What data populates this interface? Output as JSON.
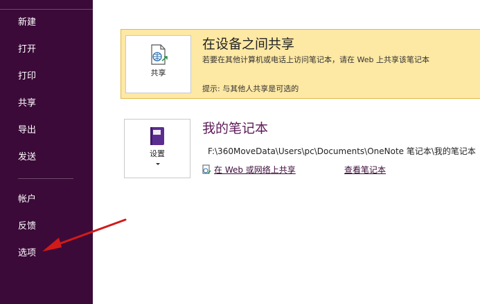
{
  "sidebar": {
    "items": [
      {
        "label": "新建"
      },
      {
        "label": "打开"
      },
      {
        "label": "打印"
      },
      {
        "label": "共享"
      },
      {
        "label": "导出"
      },
      {
        "label": "发送"
      },
      {
        "label": "帐户"
      },
      {
        "label": "反馈"
      },
      {
        "label": "选项"
      }
    ]
  },
  "share_card": {
    "button_label": "共享",
    "title": "在设备之间共享",
    "description": "若要在其他计算机或电话上访问笔记本，请在 Web 上共享该笔记本",
    "hint": "提示: 与其他人共享是可选的"
  },
  "notebook": {
    "settings_label": "设置",
    "title": "我的笔记本",
    "path": "F:\\360MoveData\\Users\\pc\\Documents\\OneNote 笔记本\\我的笔记本",
    "share_web_link": "在 Web 或网络上共享",
    "view_link": "查看笔记本"
  },
  "colors": {
    "sidebar_bg": "#3b0a38",
    "highlight_card": "#fde8a4",
    "accent_purple": "#5c1a58",
    "arrow_red": "#d21a1a"
  },
  "icons": [
    "globe-share-icon",
    "notebook-icon",
    "chevron-down-icon",
    "share-web-icon"
  ]
}
